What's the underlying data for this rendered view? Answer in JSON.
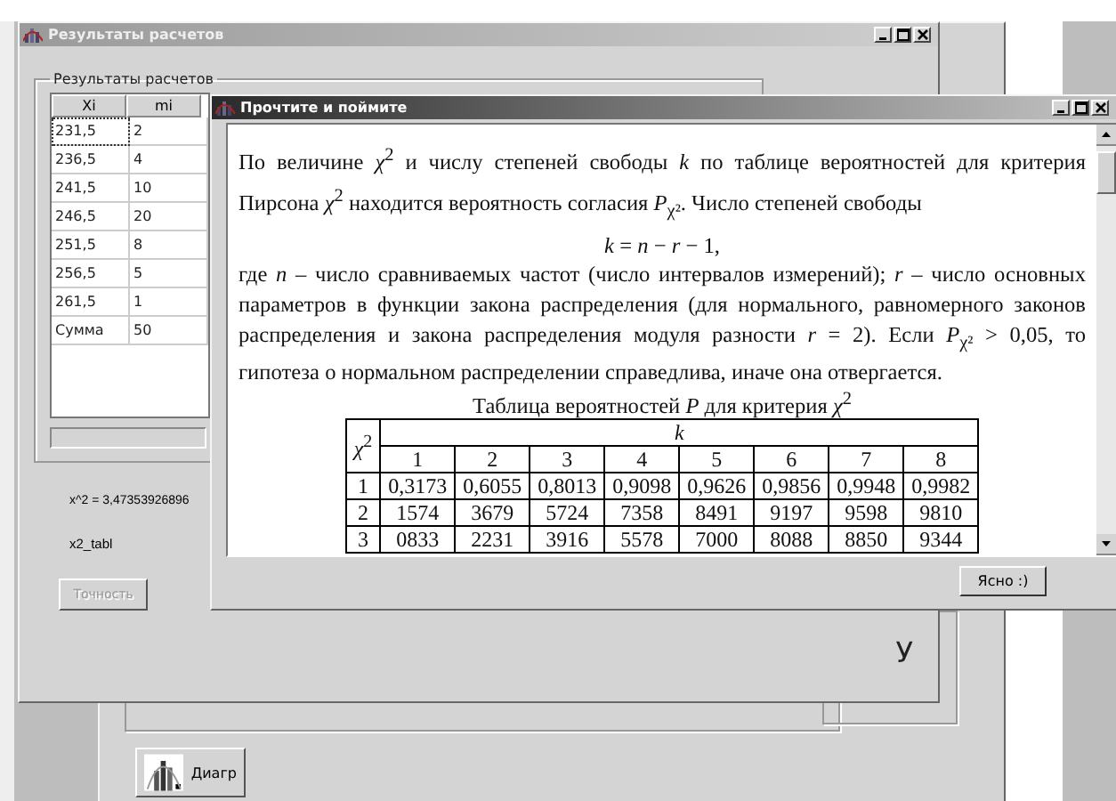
{
  "background_window": {
    "button": "Диагр"
  },
  "results_window": {
    "title": "Результаты расчетов",
    "active": false,
    "group_title": "Результаты расчетов",
    "table": {
      "columns": [
        "Xi",
        "mi"
      ],
      "rows": [
        {
          "cells": [
            "231,5",
            "2"
          ],
          "focused": true
        },
        {
          "cells": [
            "236,5",
            "4"
          ],
          "focused": false
        },
        {
          "cells": [
            "241,5",
            "10"
          ],
          "focused": false
        },
        {
          "cells": [
            "246,5",
            "20"
          ],
          "focused": false
        },
        {
          "cells": [
            "251,5",
            "8"
          ],
          "focused": false
        },
        {
          "cells": [
            "256,5",
            "5"
          ],
          "focused": false
        },
        {
          "cells": [
            "261,5",
            "1"
          ],
          "focused": false
        },
        {
          "cells": [
            "Сумма",
            "50"
          ],
          "focused": false
        }
      ]
    },
    "chi2_label": "x^2 = 3,47353926896",
    "x2_tabl_label": "x2_tabl",
    "accuracy_button": {
      "label": "Точность",
      "disabled": true
    },
    "side_label": "У"
  },
  "info_dialog": {
    "title": "Прочтите и поймите",
    "active": true,
    "blocks": [
      {
        "kind": "text",
        "text": "По величине *χ*$^{2}$ и числу степеней свободы *k* по таблице вероятностей для критерия Пирсона *χ*$^{2}$ находится вероятность согласия *P*$_{χ²}$. Число степеней свободы"
      },
      {
        "kind": "formula",
        "text": "*k* = *n* − *r* − 1,"
      },
      {
        "kind": "text",
        "text": "где *n* – число сравниваемых частот (число интервалов измерений); *r* – число основных параметров в функции закона распределения (для нормального, равномерного законов распределения и закона распределения модуля разности *r* = 2). Если *P*$_{χ²}$ > 0,05, то гипотеза о нормальном распределении справедлива, иначе она отвергается."
      },
      {
        "kind": "caption",
        "text": "Таблица вероятностей *P* для критерия *χ*$^{2}$"
      }
    ],
    "table": {
      "corner": "*χ*$^{2}$",
      "group_header": "k",
      "columns": [
        "1",
        "2",
        "3",
        "4",
        "5",
        "6",
        "7",
        "8"
      ],
      "rows": [
        {
          "label": "1",
          "cells": [
            "0,3173",
            "0,6055",
            "0,8013",
            "0,9098",
            "0,9626",
            "0,9856",
            "0,9948",
            "0,9982"
          ]
        },
        {
          "label": "2",
          "cells": [
            "1574",
            "3679",
            "5724",
            "7358",
            "8491",
            "9197",
            "9598",
            "9810"
          ]
        },
        {
          "label": "3",
          "cells": [
            "0833",
            "2231",
            "3916",
            "5578",
            "7000",
            "8088",
            "8850",
            "9344"
          ]
        }
      ]
    },
    "ok_button": "Ясно :)"
  }
}
